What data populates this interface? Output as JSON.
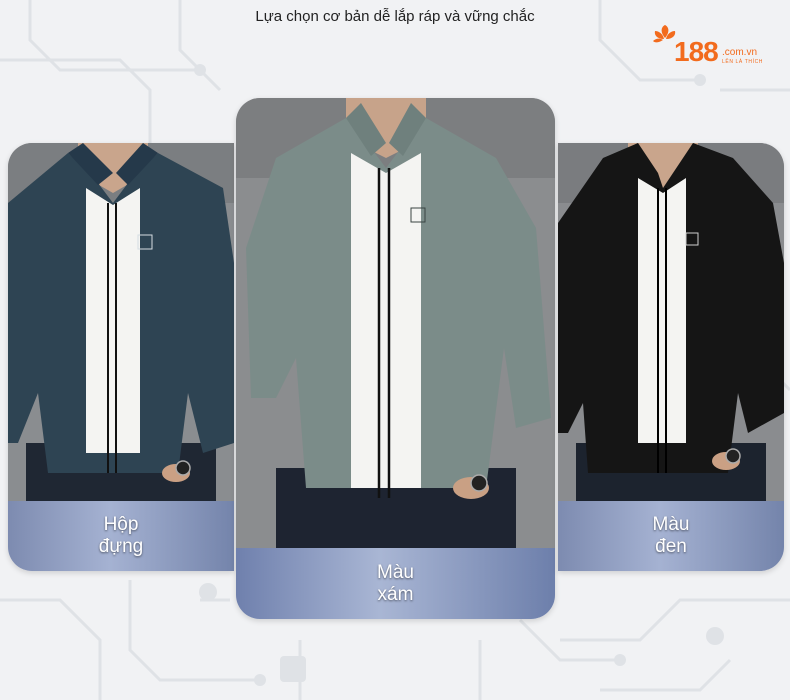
{
  "header": {
    "title": "Lựa chọn cơ bản dễ lắp ráp và vững chắc"
  },
  "logo": {
    "number": "188",
    "domain": ".com.vn",
    "slogan": "LÊN LÀ THÍCH",
    "color": "#f26b1d"
  },
  "cards": [
    {
      "caption_line1": "Hộp",
      "caption_line2": "đựng",
      "jacket_color": "#2e4453"
    },
    {
      "caption_line1": "Màu",
      "caption_line2": "xám",
      "jacket_color": "#7b8c89"
    },
    {
      "caption_line1": "Màu",
      "caption_line2": "đen",
      "jacket_color": "#151515"
    }
  ]
}
